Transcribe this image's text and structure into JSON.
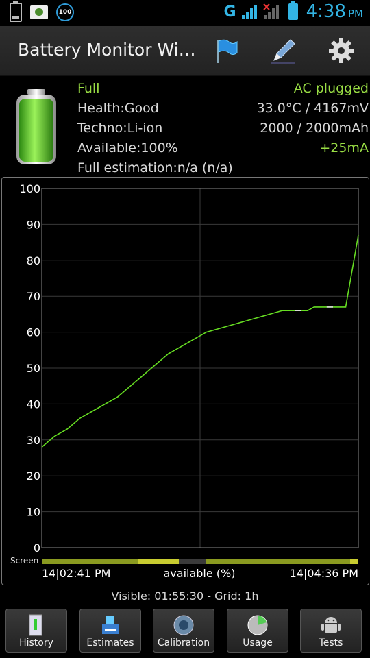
{
  "status_bar": {
    "notification_badge": "100",
    "network_type": "G",
    "sim1": "1",
    "sim2": "2",
    "time": "4:38",
    "ampm": "PM"
  },
  "app": {
    "title": "Battery Monitor Wi…"
  },
  "info": {
    "status": "Full",
    "power_source": "AC plugged",
    "health": "Health:Good",
    "temp_voltage": "33.0°C / 4167mV",
    "technology": "Techno:Li-ion",
    "capacity": "2000 / 2000mAh",
    "available": "Available:100%",
    "current": "+25mA",
    "full_estimation": "Full estimation:n/a (n/a)"
  },
  "colors": {
    "accent_blue": "#33b5e5",
    "green_text": "#99dd44",
    "chart_line": "#66dd22",
    "chart_line_segment": "#dddddd"
  },
  "chart_data": {
    "type": "line",
    "ylim": [
      0,
      100
    ],
    "yticks": [
      0,
      10,
      20,
      30,
      40,
      50,
      60,
      70,
      80,
      90,
      100
    ],
    "grid": true,
    "screen_label": "Screen",
    "x_start_label": "14|02:41 PM",
    "x_mid_label": "available (%)",
    "x_end_label": "14|04:36 PM",
    "series": [
      {
        "x": [
          0,
          4,
          8,
          12,
          16,
          20,
          24,
          28,
          32,
          36,
          40,
          44,
          48,
          52,
          56,
          60,
          64,
          68,
          72,
          76,
          80,
          82,
          84,
          86,
          88,
          90,
          92,
          96,
          100
        ],
        "values": [
          28,
          31,
          33,
          36,
          38,
          40,
          42,
          45,
          48,
          51,
          54,
          56,
          58,
          60,
          61,
          62,
          63,
          64,
          65,
          66,
          66,
          66,
          66,
          67,
          67,
          67,
          67,
          67,
          87
        ]
      }
    ],
    "visible_note": "Visible: 01:55:30 - Grid: 1h"
  },
  "buttons": [
    {
      "label": "History"
    },
    {
      "label": "Estimates"
    },
    {
      "label": "Calibration"
    },
    {
      "label": "Usage"
    },
    {
      "label": "Tests"
    }
  ]
}
